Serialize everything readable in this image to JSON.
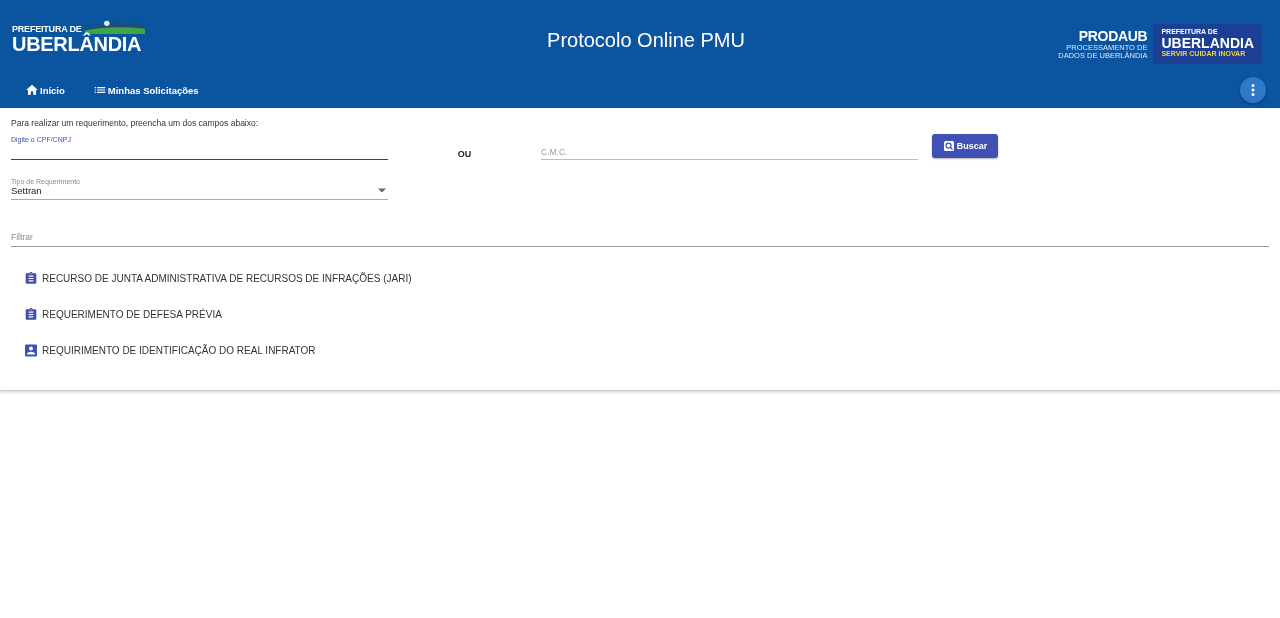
{
  "header": {
    "logo_left": {
      "line1": "PREFEITURA DE",
      "line2": "UBERLÂNDIA"
    },
    "title": "Protocolo Online PMU",
    "prodaub": {
      "name": "PRODAUB",
      "subtitle": "PROCESSAMENTO DE DADOS DE UBERLÂNDIA"
    },
    "logo_right": {
      "line1": "PREFEITURA DE",
      "line2": "UBERLANDIA",
      "slogan": "SERVIR CUIDAR INOVAR"
    },
    "nav": [
      {
        "label": "Início",
        "kind": "home"
      },
      {
        "label": "Minhas Solicitações",
        "kind": "list"
      }
    ]
  },
  "form": {
    "instruction": "Para realizar um requerimento, preencha um dos campos abaixo:",
    "cpf_field": {
      "label": "Digite o CPF/CNPJ"
    },
    "separator": "OU",
    "cmc_field": {
      "placeholder": "C.M.C."
    },
    "search_button": "Buscar",
    "type_select": {
      "label": "Tipo de Requerimento",
      "value": "Settran"
    }
  },
  "filter": {
    "placeholder": "Filtrar"
  },
  "requests": [
    {
      "label": "RECURSO DE JUNTA ADMINISTRATIVA DE RECURSOS DE INFRAÇÕES (JARI)",
      "kind": "clipboard"
    },
    {
      "label": "REQUERIMENTO DE DEFESA PRÉVIA",
      "kind": "clipboard"
    },
    {
      "label": "REQUIRIMENTO DE IDENTIFICAÇÃO DO REAL INFRATOR",
      "kind": "person"
    }
  ]
}
